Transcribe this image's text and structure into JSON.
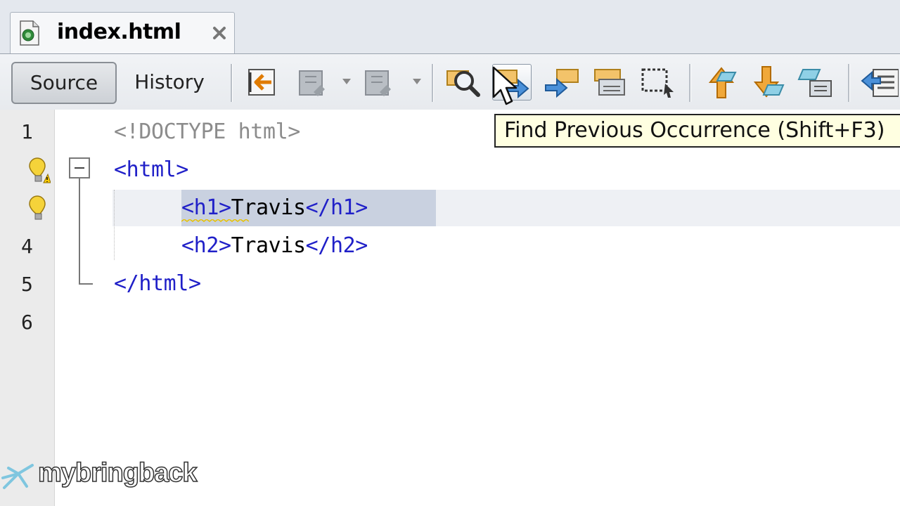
{
  "tab": {
    "title": "index.html"
  },
  "toolbar": {
    "source_label": "Source",
    "history_label": "History",
    "buttons": [
      "last-edit-icon",
      "back-icon",
      "forward-icon",
      "find-selection-icon",
      "find-previous-icon",
      "find-next-icon",
      "toggle-highlight-icon",
      "rect-selection-icon",
      "previous-bookmark-icon",
      "next-bookmark-icon",
      "toggle-bookmark-icon",
      "shift-left-icon"
    ]
  },
  "tooltip": {
    "text": "Find Previous Occurrence (Shift+F3)"
  },
  "editor": {
    "line_numbers": [
      "1",
      "4",
      "5",
      "6"
    ],
    "lines": [
      {
        "text": "<!DOCTYPE html>"
      },
      {
        "text": "<html>"
      },
      {
        "open": "<h1>",
        "content": "Travis",
        "close": "</h1>"
      },
      {
        "open": "<h2>",
        "content": "Travis",
        "close": "</h2>"
      },
      {
        "text": "</html>"
      },
      {
        "text": ""
      }
    ]
  },
  "logo": {
    "text": "mybringback"
  },
  "colors": {
    "tag": "#2020c8",
    "doctype": "#8c8c8c",
    "selection": "#c9d1e0",
    "tooltip_bg": "#ffffe1"
  }
}
